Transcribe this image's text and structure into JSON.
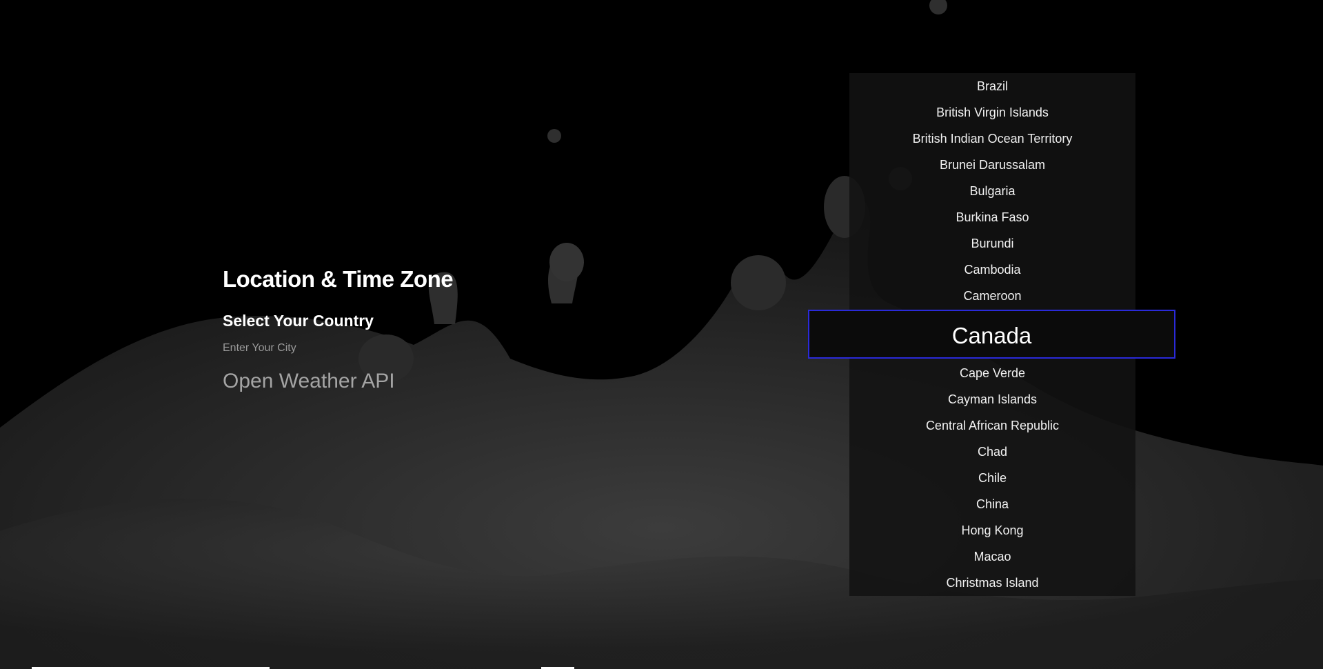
{
  "header": {
    "title": "Location & Time Zone"
  },
  "form": {
    "country_heading": "Select Your Country",
    "city_placeholder": "Enter Your City",
    "api_label": "Open Weather API"
  },
  "country_picker": {
    "items_before": [
      "Brazil",
      "British Virgin Islands",
      "British Indian Ocean Territory",
      "Brunei Darussalam",
      "Bulgaria",
      "Burkina Faso",
      "Burundi",
      "Cambodia",
      "Cameroon"
    ],
    "selected": "Canada",
    "items_after": [
      "Cape Verde",
      "Cayman Islands",
      "Central African Republic",
      "Chad",
      "Chile",
      "China",
      "Hong Kong",
      "Macao",
      "Christmas Island"
    ]
  },
  "colors": {
    "background": "#000000",
    "selection_border": "#2a2ad9",
    "muted_text": "#a4a4a4"
  }
}
